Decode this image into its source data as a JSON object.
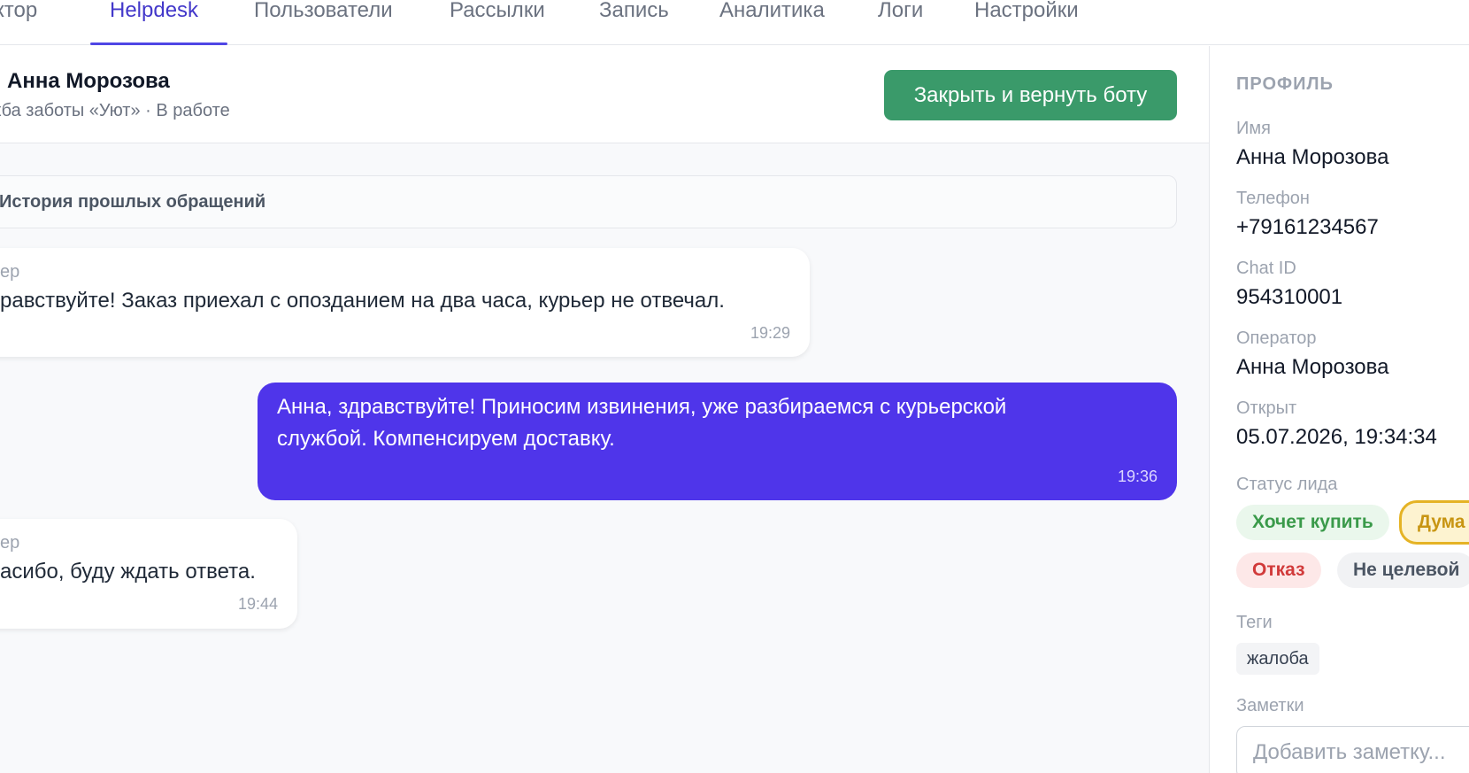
{
  "nav": {
    "items": [
      {
        "label": "уктор"
      },
      {
        "label": "Helpdesk"
      },
      {
        "label": "Пользователи"
      },
      {
        "label": "Рассылки"
      },
      {
        "label": "Запись"
      },
      {
        "label": "Аналитика"
      },
      {
        "label": "Логи"
      },
      {
        "label": "Настройки"
      }
    ],
    "active_index": 1
  },
  "chat": {
    "client_name": "Анна Морозова",
    "subtitle": "жба заботы «Уют» · В работе",
    "close_button": "Закрыть и вернуть боту",
    "history_label": "История прошлых обращений",
    "messages": [
      {
        "direction": "in",
        "sender": "ер",
        "text": "равствуйте! Заказ приехал с опозданием на два часа, курьер не отвечал.",
        "time": "19:29"
      },
      {
        "direction": "out",
        "text_line1": "Анна, здравствуйте! Приносим извинения, уже разбираемся с курьерской",
        "text_line2": "службой. Компенсируем доставку.",
        "time": "19:36"
      },
      {
        "direction": "in",
        "sender": "ер",
        "text": "асибо, буду ждать ответа.",
        "time": "19:44"
      }
    ]
  },
  "profile": {
    "heading": "ПРОФИЛЬ",
    "name_label": "Имя",
    "name_value": "Анна Морозова",
    "phone_label": "Телефон",
    "phone_value": "+79161234567",
    "chatid_label": "Chat ID",
    "chatid_value": "954310001",
    "operator_label": "Оператор",
    "operator_value": "Анна Морозова",
    "opened_label": "Открыт",
    "opened_value": "05.07.2026, 19:34:34",
    "lead_status_label": "Статус лида",
    "lead_statuses": [
      "Хочет купить",
      "Дума",
      "Отказ",
      "Не целевой"
    ],
    "selected_status": "Дума",
    "tags_label": "Теги",
    "tags": [
      "жалоба"
    ],
    "notes_label": "Заметки",
    "notes_placeholder": "Добавить заметку..."
  },
  "colors": {
    "accent": "#4f46e5",
    "outgoing_bubble": "#4f35ea",
    "close_button": "#3a9a6a"
  }
}
